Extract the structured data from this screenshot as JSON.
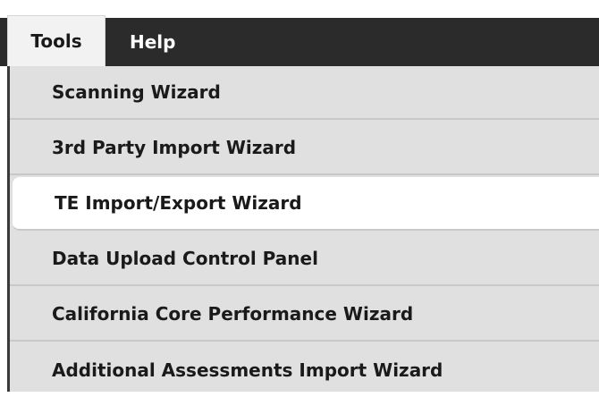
{
  "menubar": {
    "items": [
      {
        "label": "Tools",
        "active": true
      },
      {
        "label": "Help",
        "active": false
      }
    ]
  },
  "tools_menu": {
    "items": [
      {
        "label": "Scanning Wizard",
        "selected": false
      },
      {
        "label": "3rd Party Import Wizard",
        "selected": false
      },
      {
        "label": "TE Import/Export Wizard",
        "selected": true
      },
      {
        "label": "Data Upload Control Panel",
        "selected": false
      },
      {
        "label": "California Core Performance Wizard",
        "selected": false
      },
      {
        "label": "Additional Assessments Import Wizard",
        "selected": false
      }
    ]
  }
}
